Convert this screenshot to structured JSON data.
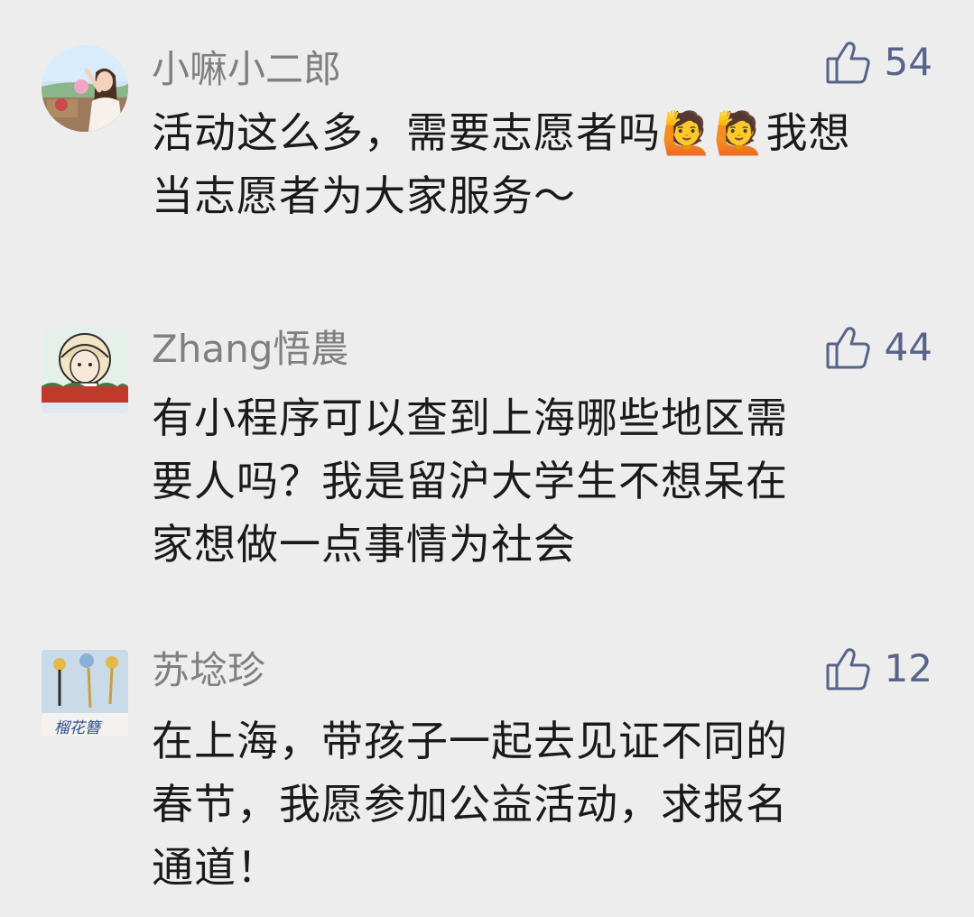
{
  "comments": [
    {
      "nickname": "小嘛小二郎",
      "likes": "54",
      "lines": [
        "活动这么多，需要志愿者吗🙋🙋我想",
        "当志愿者为大家服务～"
      ],
      "avatar": "woman-outdoor-photo"
    },
    {
      "nickname": "Zhang悟農",
      "likes": "44",
      "lines": [
        "有小程序可以查到上海哪些地区需",
        "要人吗？我是留沪大学生不想呆在",
        "家想做一点事情为社会"
      ],
      "avatar": "cartoon-girl-watermelon"
    },
    {
      "nickname": "苏埝珍",
      "likes": "12",
      "lines": [
        "在上海，带孩子一起去见证不同的",
        "春节，我愿参加公益活动，求报名",
        "通道！"
      ],
      "avatar": "flower-hairpins",
      "avatar_text": "榴花簪"
    }
  ],
  "icons": {
    "like": "thumbs-up-icon"
  },
  "colors": {
    "background": "#ededed",
    "nickname": "#7f7f7f",
    "text": "#1a1a1a",
    "like": "#56648a"
  }
}
